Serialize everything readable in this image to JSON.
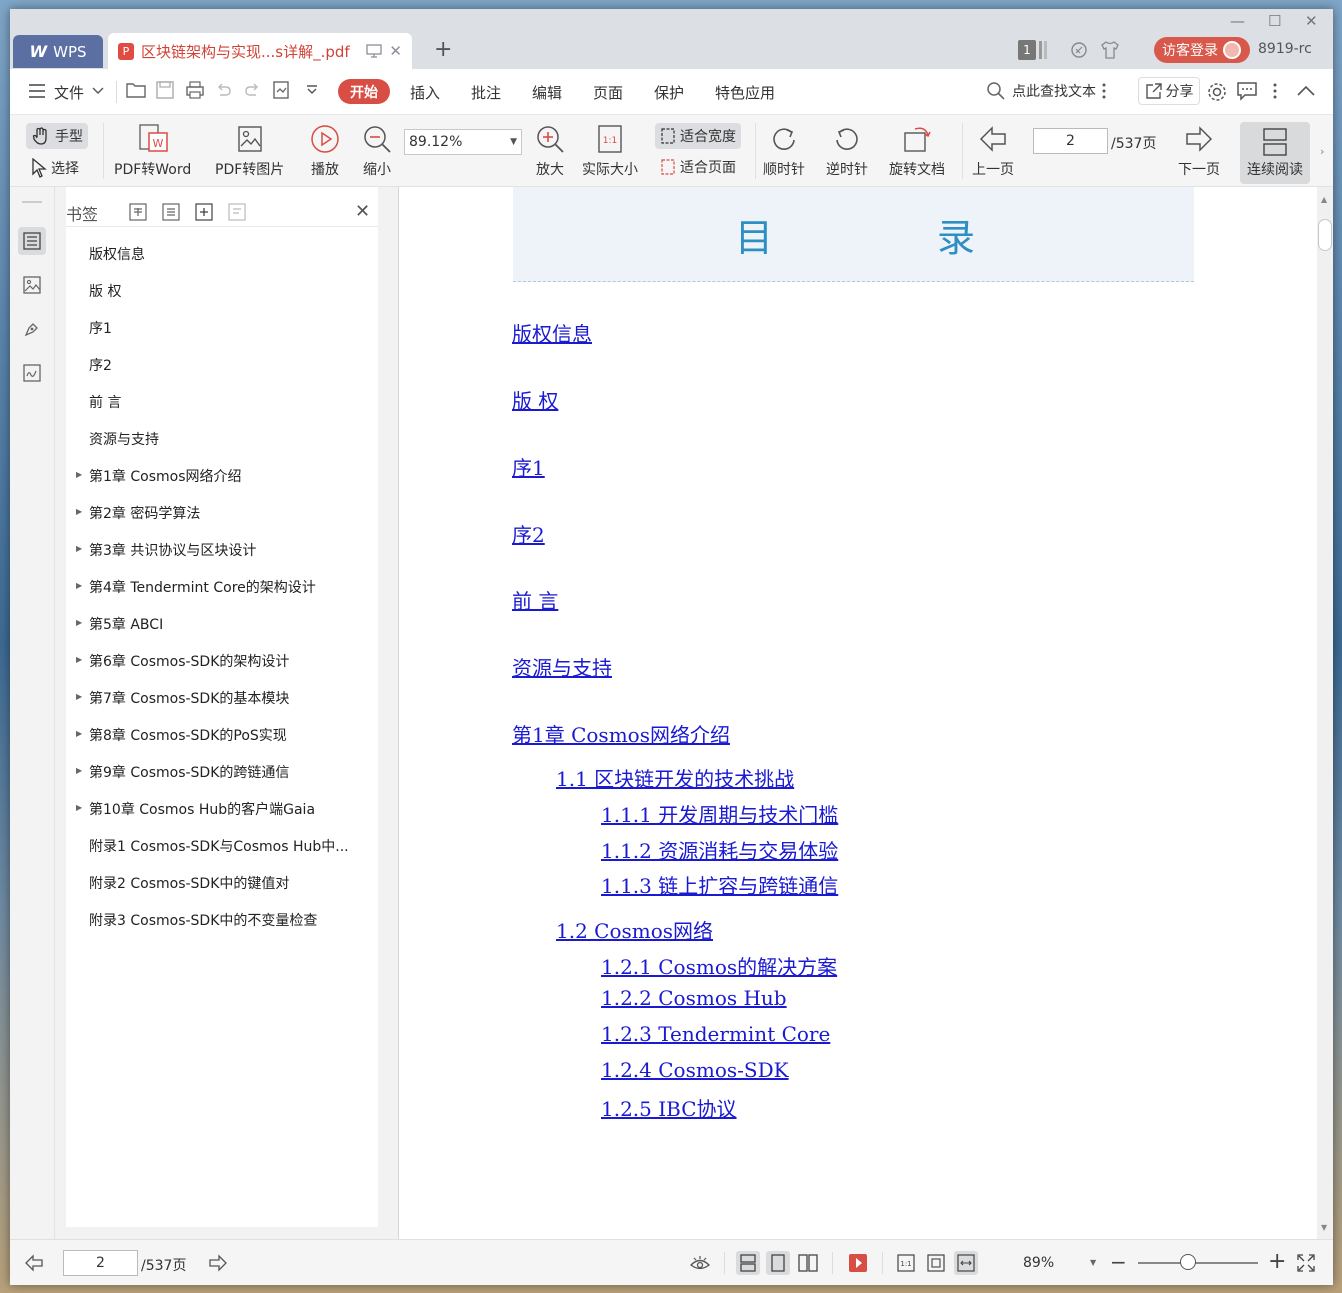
{
  "titlebar": {
    "app_tab": "WPS",
    "app_logo": "W",
    "doc_tab_title": "区块链架构与实现...s详解_.pdf",
    "pdf_badge": "P",
    "new_tab": "+",
    "badge_count": "1",
    "login_label": "访客登录",
    "user_id": "8919-rc",
    "controls": {
      "minimize": "—",
      "maximize": "☐",
      "close": "✕"
    }
  },
  "menubar": {
    "file_label": "文件",
    "tabs": [
      "开始",
      "插入",
      "批注",
      "编辑",
      "页面",
      "保护",
      "特色应用"
    ],
    "search_text": "点此查找文本",
    "share_label": "分享"
  },
  "toolbar": {
    "hand": "手型",
    "select": "选择",
    "pdf_to_word": "PDF转Word",
    "pdf_to_image": "PDF转图片",
    "play": "播放",
    "zoom_out": "缩小",
    "zoom_value": "89.12%",
    "fit_width": "适合宽度",
    "fit_page": "适合页面",
    "zoom_in": "放大",
    "actual_size": "实际大小",
    "clockwise": "顺时针",
    "counterclockwise": "逆时针",
    "rotate_doc": "旋转文档",
    "prev_page": "上一页",
    "page_current": "2",
    "page_total": "/537页",
    "next_page": "下一页",
    "continuous_read": "连续阅读"
  },
  "bookmarks": {
    "title": "书签",
    "close": "✕",
    "items": [
      {
        "label": "版权信息",
        "expandable": false
      },
      {
        "label": "版 权",
        "expandable": false
      },
      {
        "label": "序1",
        "expandable": false
      },
      {
        "label": "序2",
        "expandable": false
      },
      {
        "label": "前 言",
        "expandable": false
      },
      {
        "label": "资源与支持",
        "expandable": false
      },
      {
        "label": "第1章 Cosmos网络介绍",
        "expandable": true
      },
      {
        "label": "第2章 密码学算法",
        "expandable": true
      },
      {
        "label": "第3章 共识协议与区块设计",
        "expandable": true
      },
      {
        "label": "第4章 Tendermint Core的架构设计",
        "expandable": true
      },
      {
        "label": "第5章 ABCI",
        "expandable": true
      },
      {
        "label": "第6章 Cosmos-SDK的架构设计",
        "expandable": true
      },
      {
        "label": "第7章 Cosmos-SDK的基本模块",
        "expandable": true
      },
      {
        "label": "第8章 Cosmos-SDK的PoS实现",
        "expandable": true
      },
      {
        "label": "第9章 Cosmos-SDK的跨链通信",
        "expandable": true
      },
      {
        "label": "第10章 Cosmos Hub的客户端Gaia",
        "expandable": true
      },
      {
        "label": "附录1 Cosmos-SDK与Cosmos Hub中...",
        "expandable": false
      },
      {
        "label": "附录2 Cosmos-SDK中的键值对",
        "expandable": false
      },
      {
        "label": "附录3 Cosmos-SDK中的不变量检查",
        "expandable": false
      }
    ]
  },
  "document": {
    "toc_title_1": "目",
    "toc_title_2": "录",
    "toc": [
      "版权信息",
      "版 权",
      "序1",
      "序2",
      "前 言",
      "资源与支持",
      "第1章 Cosmos网络介绍",
      "1.1 区块链开发的技术挑战",
      "1.1.1 开发周期与技术门槛",
      "1.1.2 资源消耗与交易体验",
      "1.1.3 链上扩容与跨链通信",
      "1.2 Cosmos网络",
      "1.2.1 Cosmos的解决方案",
      "1.2.2 Cosmos Hub",
      "1.2.3 Tendermint Core",
      "1.2.4 Cosmos-SDK",
      "1.2.5 IBC协议"
    ]
  },
  "statusbar": {
    "page_current": "2",
    "page_total": "/537页",
    "zoom": "89%",
    "minus": "−",
    "plus": "+"
  },
  "colors": {
    "accent": "#d84d44",
    "link": "#1a1ad2",
    "toc_title": "#2e8fc2"
  }
}
